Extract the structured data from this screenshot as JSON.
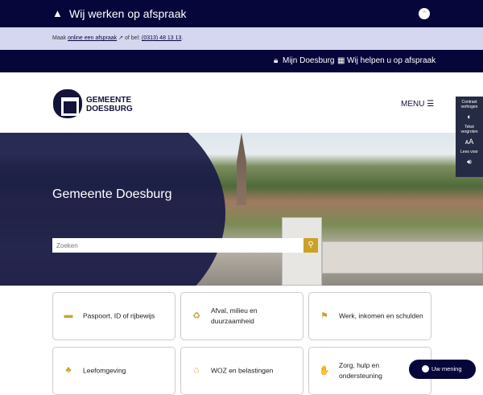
{
  "alert": {
    "title": "Wij werken op afspraak",
    "text_prefix": "Maak",
    "link": "online een afspraak",
    "text_mid": "of bel:",
    "phone": "(0313) 48 13 13",
    "text_end": "."
  },
  "topnav": {
    "items": [
      "Mijn Doesburg",
      "Wij helpen u op afspraak"
    ]
  },
  "header": {
    "logo_line1": "GEMEENTE",
    "logo_line2": "DOESBURG",
    "menu": "MENU"
  },
  "a11y": {
    "contrast": "Contrast verhogen",
    "text": "Tekst vergroten",
    "read": "Lees voor"
  },
  "hero": {
    "title": "Gemeente Doesburg",
    "search_placeholder": "Zoeken"
  },
  "cards": [
    {
      "label": "Paspoort, ID of rijbewijs",
      "icon": "id-card-icon"
    },
    {
      "label": "Afval, milieu en duurzaamheid",
      "icon": "recycle-icon"
    },
    {
      "label": "Werk, inkomen en schulden",
      "icon": "work-icon"
    },
    {
      "label": "Leefomgeving",
      "icon": "tree-icon"
    },
    {
      "label": "WOZ en belastingen",
      "icon": "house-icon"
    },
    {
      "label": "Zorg, hulp en ondersteuning",
      "icon": "handshake-icon"
    }
  ],
  "feedback": {
    "label": "Uw mening"
  },
  "colors": {
    "navy": "#07063a",
    "gold": "#c9a227",
    "lilac": "#d4d7ef"
  }
}
